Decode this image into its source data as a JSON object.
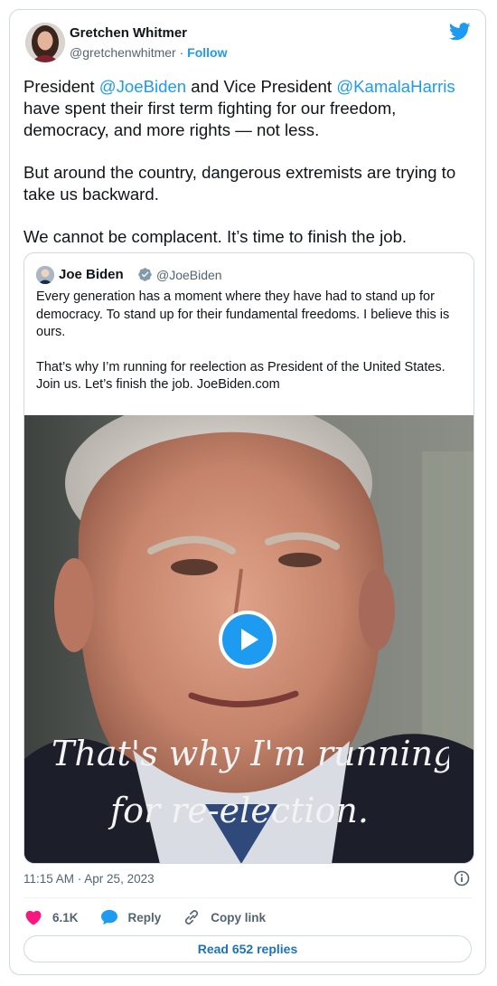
{
  "tweet": {
    "author_name": "Gretchen Whitmer",
    "author_handle": "@gretchenwhitmer",
    "separator": " · ",
    "follow_label": "Follow",
    "body": {
      "p1_a": "President ",
      "p1_mention1": "@JoeBiden",
      "p1_b": " and Vice President ",
      "p1_mention2": "@KamalaHarris",
      "p1_c": " have spent their first term fighting for our freedom, democracy, and more rights — not less.",
      "p2": "But around the country, dangerous extremists are trying to take us backward.",
      "p3": "We cannot be complacent. It’s time to finish the job."
    },
    "timestamp": "11:15 AM · Apr 25, 2023",
    "likes_count": "6.1K",
    "reply_label": "Reply",
    "copy_link_label": "Copy link",
    "read_replies_label": "Read 652 replies"
  },
  "quoted": {
    "author_name": "Joe Biden",
    "author_handle": "@JoeBiden",
    "p1": "Every generation has a moment where they have had to stand up for democracy. To stand up for their fundamental freedoms. I believe this is ours.",
    "p2": "That’s why I’m running for reelection as President of the United States. Join us. Let’s finish the job. JoeBiden.com",
    "video_caption_line1": "That's why I'm running",
    "video_caption_line2": "for re-election."
  },
  "colors": {
    "accent": "#1d9bf0",
    "like": "#f91880",
    "text": "#0f1419",
    "muted": "#536471",
    "border": "#cfd9de"
  },
  "icons": [
    "twitter-bird-icon",
    "verified-badge-icon",
    "play-icon",
    "info-icon",
    "heart-icon",
    "reply-bubble-icon",
    "link-icon"
  ]
}
